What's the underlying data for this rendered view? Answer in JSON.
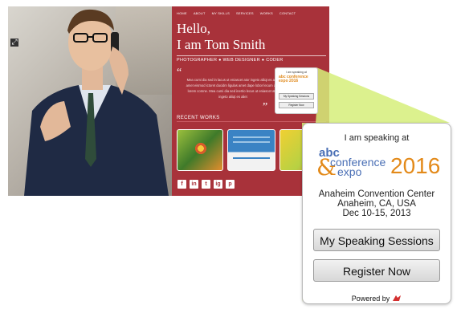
{
  "site": {
    "nav": [
      "HOME",
      "ABOUT",
      "MY SKILLS",
      "SERVICES",
      "WORKS",
      "CONTACT"
    ],
    "hello_line1": "Hello,",
    "hello_line2": "I am Tom Smith",
    "roles": "PHOTOGRAPHER  ●  WEB DESIGNER  ●  CODER",
    "quote_open": "“",
    "quote_close": "”",
    "quote_text": "Mea cumi dia sed in lacus ut eniascet ator ingeto aliiqt es aliet amet eismod ictoret ducidm ligulas amet dape lobor lecum duis lorem comne. Mea cumi dia sed inertio lecus ut eniascet ator ingeto aliiqt es aliet",
    "recent_works": "RECENT WORKS",
    "social": [
      "f",
      "in",
      "t",
      "ig",
      "p"
    ]
  },
  "mini_widget": {
    "title": "I am speaking at",
    "logo": "abc conference expo 2016",
    "btn1": "My Speaking Sessions",
    "btn2": "Register Now"
  },
  "widget": {
    "title": "I am speaking at",
    "logo_abc": "abc",
    "logo_amp": "&",
    "logo_conference": "conference",
    "logo_expo": "expo",
    "logo_year": "2016",
    "location_line1": "Anaheim Convention Center",
    "location_line2": "Anaheim, CA, USA",
    "location_line3": "Dec 10-15, 2013",
    "btn_sessions": "My Speaking Sessions",
    "btn_register": "Register Now",
    "powered_by": "Powered by"
  },
  "colors": {
    "panel": "#a8323a",
    "callout": "#d6ef7a",
    "logo_blue": "#4a6fb5",
    "logo_orange": "#e38a1a"
  },
  "icons": [
    "arrows-icon",
    "facebook-icon",
    "linkedin-icon",
    "twitter-icon",
    "instagram-icon",
    "pinterest-icon",
    "powered-by-logo-icon"
  ]
}
